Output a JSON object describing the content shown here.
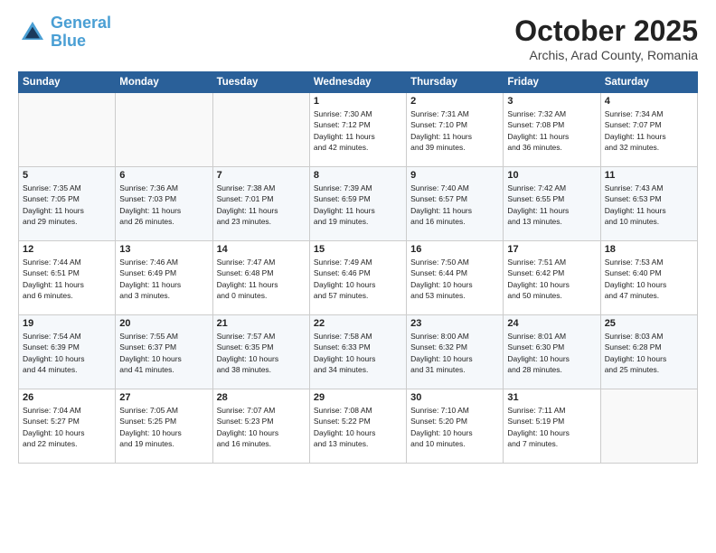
{
  "header": {
    "logo_line1": "General",
    "logo_line2": "Blue",
    "month": "October 2025",
    "location": "Archis, Arad County, Romania"
  },
  "weekdays": [
    "Sunday",
    "Monday",
    "Tuesday",
    "Wednesday",
    "Thursday",
    "Friday",
    "Saturday"
  ],
  "weeks": [
    [
      {
        "day": "",
        "info": ""
      },
      {
        "day": "",
        "info": ""
      },
      {
        "day": "",
        "info": ""
      },
      {
        "day": "1",
        "info": "Sunrise: 7:30 AM\nSunset: 7:12 PM\nDaylight: 11 hours\nand 42 minutes."
      },
      {
        "day": "2",
        "info": "Sunrise: 7:31 AM\nSunset: 7:10 PM\nDaylight: 11 hours\nand 39 minutes."
      },
      {
        "day": "3",
        "info": "Sunrise: 7:32 AM\nSunset: 7:08 PM\nDaylight: 11 hours\nand 36 minutes."
      },
      {
        "day": "4",
        "info": "Sunrise: 7:34 AM\nSunset: 7:07 PM\nDaylight: 11 hours\nand 32 minutes."
      }
    ],
    [
      {
        "day": "5",
        "info": "Sunrise: 7:35 AM\nSunset: 7:05 PM\nDaylight: 11 hours\nand 29 minutes."
      },
      {
        "day": "6",
        "info": "Sunrise: 7:36 AM\nSunset: 7:03 PM\nDaylight: 11 hours\nand 26 minutes."
      },
      {
        "day": "7",
        "info": "Sunrise: 7:38 AM\nSunset: 7:01 PM\nDaylight: 11 hours\nand 23 minutes."
      },
      {
        "day": "8",
        "info": "Sunrise: 7:39 AM\nSunset: 6:59 PM\nDaylight: 11 hours\nand 19 minutes."
      },
      {
        "day": "9",
        "info": "Sunrise: 7:40 AM\nSunset: 6:57 PM\nDaylight: 11 hours\nand 16 minutes."
      },
      {
        "day": "10",
        "info": "Sunrise: 7:42 AM\nSunset: 6:55 PM\nDaylight: 11 hours\nand 13 minutes."
      },
      {
        "day": "11",
        "info": "Sunrise: 7:43 AM\nSunset: 6:53 PM\nDaylight: 11 hours\nand 10 minutes."
      }
    ],
    [
      {
        "day": "12",
        "info": "Sunrise: 7:44 AM\nSunset: 6:51 PM\nDaylight: 11 hours\nand 6 minutes."
      },
      {
        "day": "13",
        "info": "Sunrise: 7:46 AM\nSunset: 6:49 PM\nDaylight: 11 hours\nand 3 minutes."
      },
      {
        "day": "14",
        "info": "Sunrise: 7:47 AM\nSunset: 6:48 PM\nDaylight: 11 hours\nand 0 minutes."
      },
      {
        "day": "15",
        "info": "Sunrise: 7:49 AM\nSunset: 6:46 PM\nDaylight: 10 hours\nand 57 minutes."
      },
      {
        "day": "16",
        "info": "Sunrise: 7:50 AM\nSunset: 6:44 PM\nDaylight: 10 hours\nand 53 minutes."
      },
      {
        "day": "17",
        "info": "Sunrise: 7:51 AM\nSunset: 6:42 PM\nDaylight: 10 hours\nand 50 minutes."
      },
      {
        "day": "18",
        "info": "Sunrise: 7:53 AM\nSunset: 6:40 PM\nDaylight: 10 hours\nand 47 minutes."
      }
    ],
    [
      {
        "day": "19",
        "info": "Sunrise: 7:54 AM\nSunset: 6:39 PM\nDaylight: 10 hours\nand 44 minutes."
      },
      {
        "day": "20",
        "info": "Sunrise: 7:55 AM\nSunset: 6:37 PM\nDaylight: 10 hours\nand 41 minutes."
      },
      {
        "day": "21",
        "info": "Sunrise: 7:57 AM\nSunset: 6:35 PM\nDaylight: 10 hours\nand 38 minutes."
      },
      {
        "day": "22",
        "info": "Sunrise: 7:58 AM\nSunset: 6:33 PM\nDaylight: 10 hours\nand 34 minutes."
      },
      {
        "day": "23",
        "info": "Sunrise: 8:00 AM\nSunset: 6:32 PM\nDaylight: 10 hours\nand 31 minutes."
      },
      {
        "day": "24",
        "info": "Sunrise: 8:01 AM\nSunset: 6:30 PM\nDaylight: 10 hours\nand 28 minutes."
      },
      {
        "day": "25",
        "info": "Sunrise: 8:03 AM\nSunset: 6:28 PM\nDaylight: 10 hours\nand 25 minutes."
      }
    ],
    [
      {
        "day": "26",
        "info": "Sunrise: 7:04 AM\nSunset: 5:27 PM\nDaylight: 10 hours\nand 22 minutes."
      },
      {
        "day": "27",
        "info": "Sunrise: 7:05 AM\nSunset: 5:25 PM\nDaylight: 10 hours\nand 19 minutes."
      },
      {
        "day": "28",
        "info": "Sunrise: 7:07 AM\nSunset: 5:23 PM\nDaylight: 10 hours\nand 16 minutes."
      },
      {
        "day": "29",
        "info": "Sunrise: 7:08 AM\nSunset: 5:22 PM\nDaylight: 10 hours\nand 13 minutes."
      },
      {
        "day": "30",
        "info": "Sunrise: 7:10 AM\nSunset: 5:20 PM\nDaylight: 10 hours\nand 10 minutes."
      },
      {
        "day": "31",
        "info": "Sunrise: 7:11 AM\nSunset: 5:19 PM\nDaylight: 10 hours\nand 7 minutes."
      },
      {
        "day": "",
        "info": ""
      }
    ]
  ]
}
